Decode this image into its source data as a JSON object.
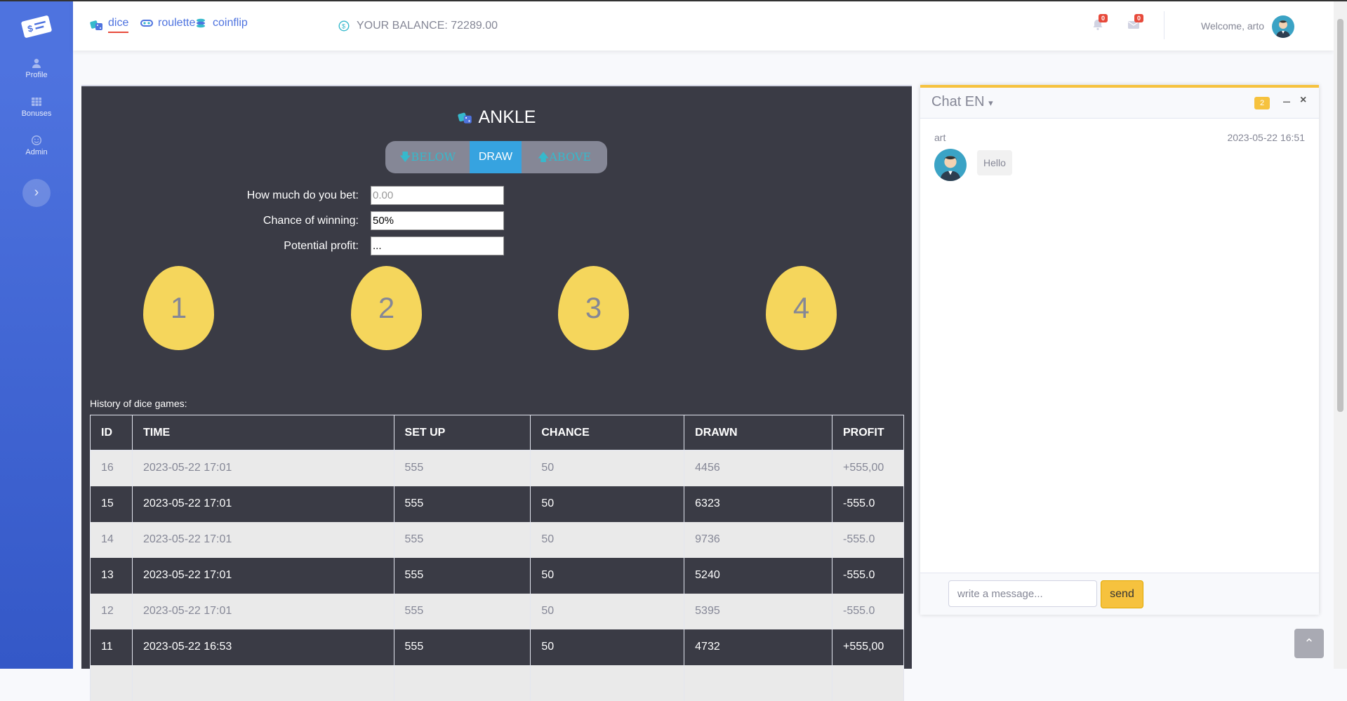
{
  "sidebar": {
    "items": [
      {
        "label": "Profile",
        "icon": "user-icon"
      },
      {
        "label": "Bonuses",
        "icon": "table-icon"
      },
      {
        "label": "Admin",
        "icon": "smile-icon"
      }
    ],
    "toggle_icon": "chevron-right-icon"
  },
  "topbar": {
    "tabs": [
      {
        "label": "dice",
        "icon": "dice-icon",
        "active": true
      },
      {
        "label": "roulette",
        "icon": "ring-icon",
        "active": false
      },
      {
        "label": "coinflip",
        "icon": "coins-icon",
        "active": false
      }
    ],
    "balance": "YOUR BALANCE: 72289.00",
    "notifications_count": "0",
    "messages_count": "0",
    "welcome": "Welcome, arto"
  },
  "game": {
    "title": "ANKLE",
    "buttons": {
      "below": "BELOW",
      "draw": "DRAW",
      "above": "ABOVE"
    },
    "form": {
      "bet_label": "How much do you bet:",
      "bet_placeholder": "0.00",
      "chance_label": "Chance of winning:",
      "chance_value": "50%",
      "profit_label": "Potential profit:",
      "profit_value": "..."
    },
    "eggs": [
      "1",
      "2",
      "3",
      "4"
    ],
    "history_label": "History of dice games:",
    "history_columns": [
      "ID",
      "TIME",
      "SET UP",
      "CHANCE",
      "DRAWN",
      "PROFIT"
    ],
    "history_rows": [
      [
        "16",
        "2023-05-22 17:01",
        "555",
        "50",
        "4456",
        "+555,00"
      ],
      [
        "15",
        "2023-05-22 17:01",
        "555",
        "50",
        "6323",
        "-555.0"
      ],
      [
        "14",
        "2023-05-22 17:01",
        "555",
        "50",
        "9736",
        "-555.0"
      ],
      [
        "13",
        "2023-05-22 17:01",
        "555",
        "50",
        "5240",
        "-555.0"
      ],
      [
        "12",
        "2023-05-22 17:01",
        "555",
        "50",
        "5395",
        "-555.0"
      ],
      [
        "11",
        "2023-05-22 16:53",
        "555",
        "50",
        "4732",
        "+555,00"
      ]
    ]
  },
  "chat": {
    "title": "Chat EN",
    "unread": "2",
    "message": {
      "user": "art",
      "time": "2023-05-22 16:51",
      "text": "Hello"
    },
    "input_placeholder": "write a message...",
    "send_label": "send"
  },
  "colors": {
    "sidebar": "#4e73df",
    "accent": "#f6c23e",
    "panel": "#3a3b45",
    "egg": "#f5d65c",
    "danger": "#e74a3b"
  }
}
